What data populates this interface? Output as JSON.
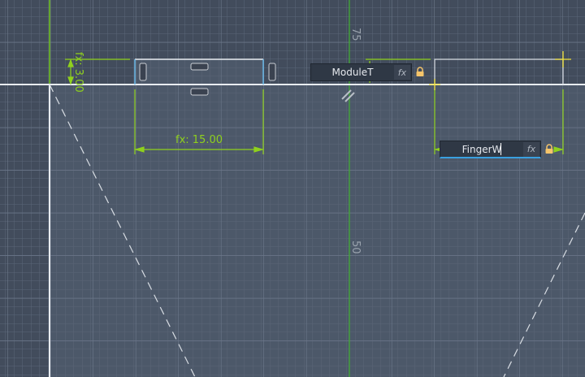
{
  "sketch": {
    "axis_labels": [
      "75",
      "50"
    ],
    "dimensions": [
      {
        "label": "fx: 3.00"
      },
      {
        "label": "fx: 15.00"
      }
    ],
    "inputs": [
      {
        "value": "ModuleT",
        "fx_label": "fx",
        "locked": true
      },
      {
        "value": "FingerW",
        "fx_label": "fx",
        "locked": true,
        "active": true
      }
    ]
  },
  "colors": {
    "dimension": "#8fd11d",
    "axis": "#3fb02f",
    "sketch_line": "#e8ecf0",
    "selected": "#6ab8e8",
    "point": "#f2e23a",
    "lock": "#f5c46a"
  }
}
